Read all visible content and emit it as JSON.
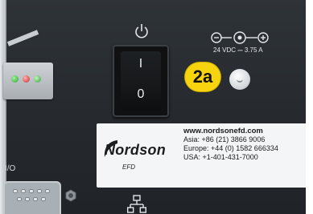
{
  "callout": {
    "label": "2a"
  },
  "switch": {
    "on_label": "I",
    "off_label": "0"
  },
  "power_input": {
    "rating": "24 VDC ⎓ 3.75 A"
  },
  "label_plate": {
    "brand": "Nordson",
    "brand_sub": "EFD",
    "website": "www.nordsonefd.com",
    "asia": "Asia: +86 (21) 3866 9006",
    "europe": "Europe: +44 (0) 1582 666334",
    "usa": "USA: +1-401-431-7000"
  },
  "io_port": {
    "label": "I/O"
  },
  "colors": {
    "panel": "#2a2e32",
    "callout": "#f7d40d",
    "plate": "#f4f5f6"
  },
  "icons": [
    "power-icon",
    "polarity-symbol",
    "network-icon",
    "nordson-logo"
  ]
}
